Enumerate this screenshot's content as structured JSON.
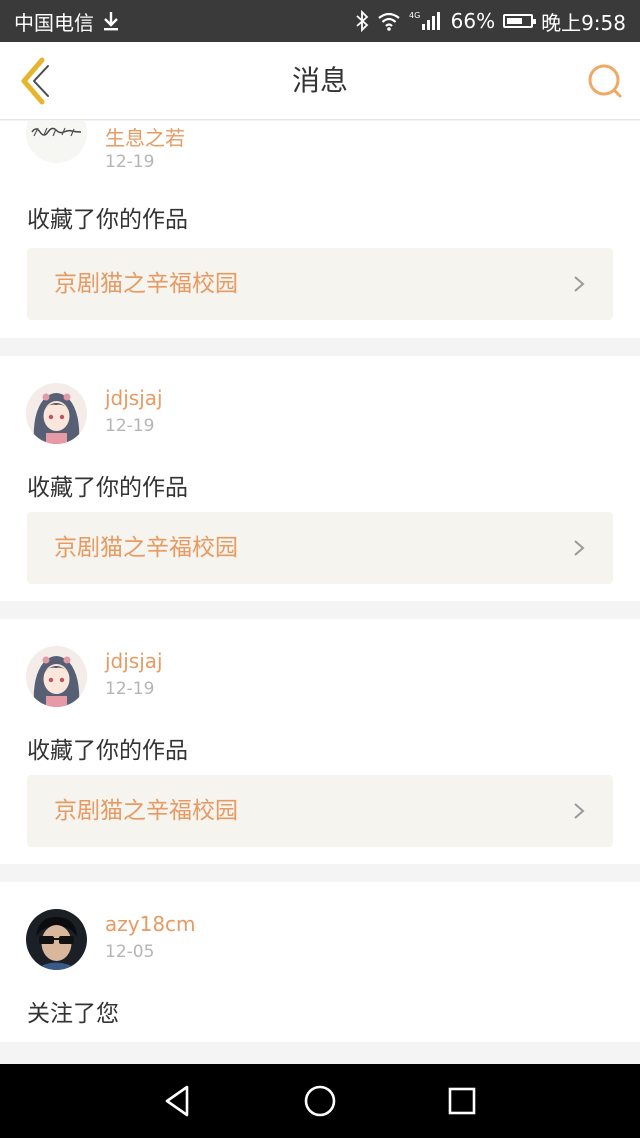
{
  "status_bar": {
    "carrier": "中国电信",
    "network": "4G",
    "battery": "66%",
    "battery_level": 0.66,
    "time": "晚上9:58"
  },
  "header": {
    "title": "消息",
    "back_icon": "chevron-left-icon",
    "search_icon": "search-icon"
  },
  "notifications": [
    {
      "user": "生息之若",
      "date": "12-19",
      "action": "收藏了你的作品",
      "work": "京剧猫之辛福校园",
      "avatar": "calligraphy-avatar"
    },
    {
      "user": "jdjsjaj",
      "date": "12-19",
      "action": "收藏了你的作品",
      "work": "京剧猫之辛福校园",
      "avatar": "anime-girl-avatar"
    },
    {
      "user": "jdjsjaj",
      "date": "12-19",
      "action": "收藏了你的作品",
      "work": "京剧猫之辛福校园",
      "avatar": "anime-girl-avatar"
    },
    {
      "user": "azy18cm",
      "date": "12-05",
      "action": "关注了您",
      "avatar": "sunglasses-man-avatar"
    }
  ],
  "colors": {
    "accent": "#e79a62",
    "back_icon": "#e6b52d",
    "status_bar_bg": "#3a3a3a",
    "page_bg": "#f4f4f4",
    "work_bg": "#f5f4ef"
  },
  "nav": {
    "back_icon": "triangle-back-icon",
    "home_icon": "circle-home-icon",
    "recents_icon": "square-recents-icon"
  }
}
